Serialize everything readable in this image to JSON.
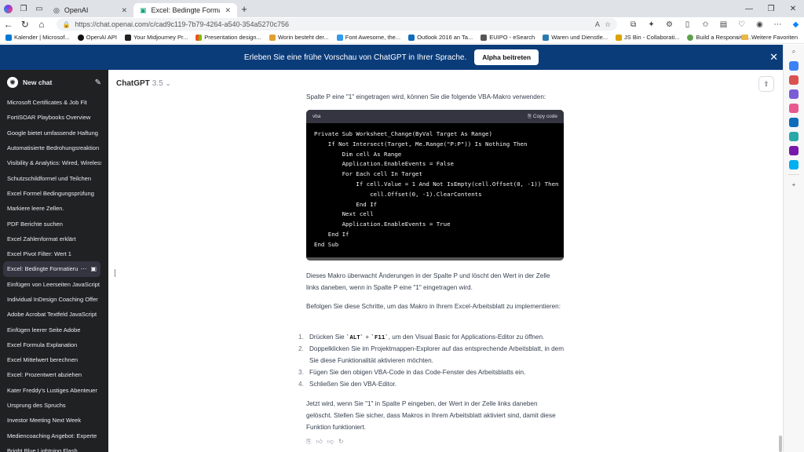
{
  "browser": {
    "tabs": [
      {
        "label": "OpenAI",
        "active": false
      },
      {
        "label": "Excel: Bedingte Formatierung un",
        "active": true
      }
    ],
    "url": "https://chat.openai.com/c/cad9c119-7b79-4264-a540-354a5270c756",
    "bookmarks": [
      {
        "label": "Kalender | Microsof...",
        "color": "#0078d4"
      },
      {
        "label": "OpenAI API",
        "color": "#111111"
      },
      {
        "label": "Your Midjourney Pr...",
        "color": "#222222"
      },
      {
        "label": "Presentation design...",
        "color": "#f25022"
      },
      {
        "label": "Worin besteht der...",
        "color": "#e0a030"
      },
      {
        "label": "Font Awesome, the...",
        "color": "#339af0"
      },
      {
        "label": "Outlook 2016 an Ta...",
        "color": "#0f6cbd"
      },
      {
        "label": "EUIPO - eSearch",
        "color": "#555555"
      },
      {
        "label": "Waren und Dienstle...",
        "color": "#2a7ab0"
      },
      {
        "label": "JS Bin - Collaborati...",
        "color": "#d9a300"
      },
      {
        "label": "Build a Responsive...",
        "color": "#5fa04e"
      }
    ],
    "other_favorites": "Weitere Favoriten"
  },
  "banner": {
    "text": "Erleben Sie eine frühe Vorschau von ChatGPT in Ihrer Sprache.",
    "button": "Alpha beitreten"
  },
  "sidebar": {
    "new_chat": "New chat",
    "chats": [
      "Microsoft Certificates & Job Fit",
      "FortiSOAR Playbooks Overview",
      "Google bietet umfassende Haftung",
      "Automatisierte Bedrohungsreaktion",
      "Visibility & Analytics: Wired, Wireless",
      "Schutzschildformel und Teilchen",
      "Excel Formel Bedingungsprüfung",
      "Markiere leere Zellen.",
      "PDF Berichte suchen",
      "Excel Zahlenformat erklärt",
      "Excel Pivot Filter: Wert 1",
      "Excel: Bedingte Formatierung",
      "Einfügen von Leerseiten JavaScript",
      "Individual InDesign Coaching Offer",
      "Adobe Acrobat Textfeld JavaScript",
      "Einfügen leerer Seite Adobe",
      "Excel Formula Explanation",
      "Excel Mittelwert berechnen",
      "Excel: Prozentwert abziehen",
      "Kater Freddy's Lustiges Abenteuer",
      "Ursprung des Spruchs",
      "Investor Meeting Next Week",
      "Mediencoaching Angebot: Experte",
      "Bright Blue Lightning Flash"
    ],
    "selected_index": 11
  },
  "main": {
    "model_name": "ChatGPT",
    "model_version": "3.5",
    "intro_text": "Spalte P eine \"1\" eingetragen wird, können Sie die folgende VBA-Makro verwenden:",
    "code": {
      "language": "vba",
      "copy_label": "Copy code",
      "lines": [
        "Private Sub Worksheet_Change(ByVal Target As Range)",
        "    If Not Intersect(Target, Me.Range(\"P:P\")) Is Nothing Then",
        "        Dim cell As Range",
        "        Application.EnableEvents = False",
        "        For Each cell In Target",
        "            If cell.Value = 1 And Not IsEmpty(cell.Offset(0, -1)) Then",
        "                cell.Offset(0, -1).ClearContents",
        "            End If",
        "        Next cell",
        "        Application.EnableEvents = True",
        "    End If",
        "End Sub"
      ]
    },
    "paragraph1": "Dieses Makro überwacht Änderungen in der Spalte P und löscht den Wert in der Zelle links daneben, wenn in Spalte P eine \"1\" eingetragen wird.",
    "paragraph2": "Befolgen Sie diese Schritte, um das Makro in Ihrem Excel-Arbeitsblatt zu implementieren:",
    "steps": {
      "step1_pre": "Drücken Sie ",
      "step1_key1": "`ALT`",
      "step1_plus": " + ",
      "step1_key2": "`F11`",
      "step1_post": ", um den Visual Basic for Applications-Editor zu öffnen.",
      "step2": "Doppelklicken Sie im Projektmappen-Explorer auf das entsprechende Arbeitsblatt, in dem Sie diese Funktionalität aktivieren möchten.",
      "step3": "Fügen Sie den obigen VBA-Code in das Code-Fenster des Arbeitsblatts ein.",
      "step4": "Schließen Sie den VBA-Editor."
    },
    "paragraph3": "Jetzt wird, wenn Sie \"1\" in Spalte P eingeben, der Wert in der Zelle links daneben gelöscht. Stellen Sie sicher, dass Makros in Ihrem Arbeitsblatt aktiviert sind, damit diese Funktion funktioniert."
  }
}
